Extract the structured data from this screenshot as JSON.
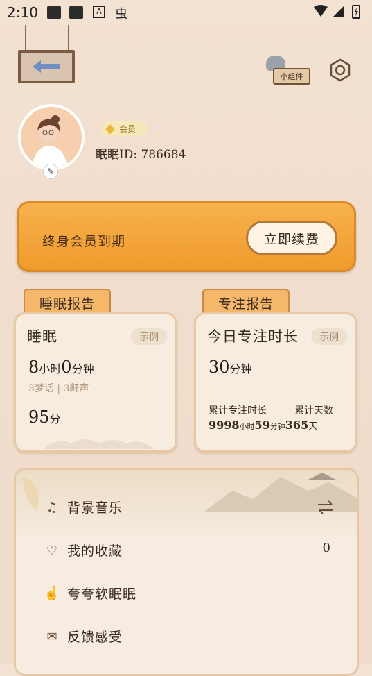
{
  "status_bar": {
    "time": "2:10",
    "a_badge": "A",
    "bug_glyph": "虫"
  },
  "header": {
    "widget_label": "小组件"
  },
  "profile": {
    "vip_label": "会员",
    "user_id_label": "眠眠ID: 786684"
  },
  "member_banner": {
    "text": "终身会员到期",
    "renew_label": "立即续费"
  },
  "sleep_report": {
    "tab_label": "睡眠报告",
    "title": "睡眠",
    "sample_label": "示例",
    "hours": "8",
    "hours_unit": "小时",
    "minutes": "0",
    "minutes_unit": "分钟",
    "sub": "3梦话 | 3鼾声",
    "score": "95",
    "score_unit": "分"
  },
  "focus_report": {
    "tab_label": "专注报告",
    "title": "今日专注时长",
    "sample_label": "示例",
    "minutes": "30",
    "minutes_unit": "分钟",
    "cum_duration_label": "累计专注时长",
    "cum_days_label": "累计天数",
    "cum_hours": "9998",
    "cum_hours_unit": "小时",
    "cum_minutes": "59",
    "cum_minutes_unit": "分钟",
    "cum_days": "365",
    "cum_days_unit": "天"
  },
  "menu": {
    "items": [
      {
        "label": "背景音乐",
        "icon": "music-note-icon"
      },
      {
        "label": "我的收藏",
        "icon": "heart-icon",
        "value": "0"
      },
      {
        "label": "夸夸软眠眠",
        "icon": "thumb-icon"
      },
      {
        "label": "反馈感受",
        "icon": "mail-icon"
      }
    ]
  },
  "colors": {
    "banner": "#f3a23a",
    "tab": "#f5b76a",
    "card": "#f6ece0",
    "accent_back": "#6f8fc4"
  }
}
